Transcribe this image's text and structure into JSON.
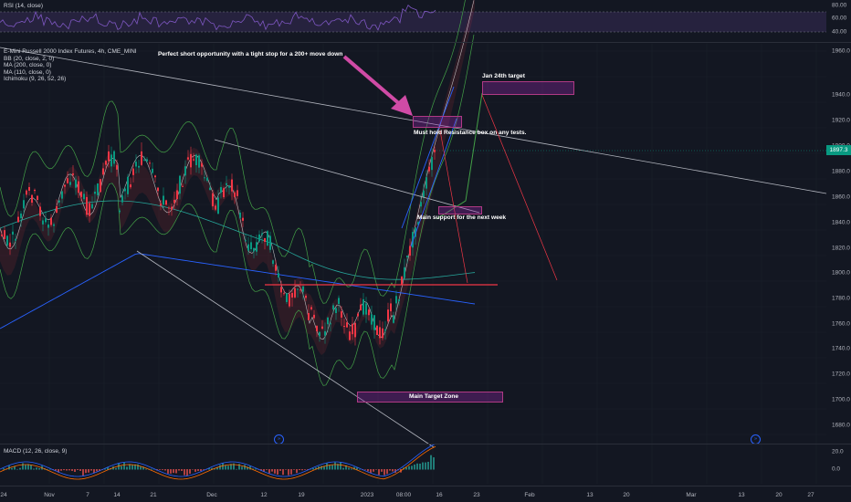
{
  "colors": {
    "bg": "#131722",
    "up": "#089981",
    "down": "#f23645",
    "accent": "#9c27b0",
    "blue": "#2962ff",
    "grid": "#1e222d"
  },
  "rsi": {
    "legend": "RSI (14, close)",
    "axis": [
      "80.00",
      "60.00",
      "40.00"
    ]
  },
  "main": {
    "legend": [
      "E-Mini Russell 2000 Index Futures, 4h, CME_MINI",
      "BB (20, close, 2, 0)",
      "MA (200, close, 0)",
      "MA (110, close, 0)",
      "Ichimoku (9, 26, 52, 26)"
    ],
    "price_axis": [
      "1960.0",
      "1940.0",
      "1920.0",
      "1900.0",
      "1880.0",
      "1860.0",
      "1840.0",
      "1820.0",
      "1800.0",
      "1780.0",
      "1760.0",
      "1740.0",
      "1720.0",
      "1700.0",
      "1680.0"
    ],
    "last_price": "1897.3",
    "annotations": {
      "short": "Perfect short opportunity with a tight stop for a 200+ move down",
      "jan24": "Jan 24th target",
      "resist": "Must hold Resistance box on any tests.",
      "support": "Main support for the next week",
      "target": "Main Target Zone"
    },
    "event_icons": [
      "»",
      "»"
    ]
  },
  "macd": {
    "legend": "MACD (12, 26, close, 9)",
    "axis": [
      "20.0",
      "0.0"
    ]
  },
  "time_axis": [
    "24",
    "Nov",
    "7",
    "14",
    "21",
    "Dec",
    "12",
    "19",
    "2023",
    "08:00",
    "16",
    "23",
    "Feb",
    "13",
    "20",
    "Mar",
    "13",
    "20",
    "27"
  ]
}
